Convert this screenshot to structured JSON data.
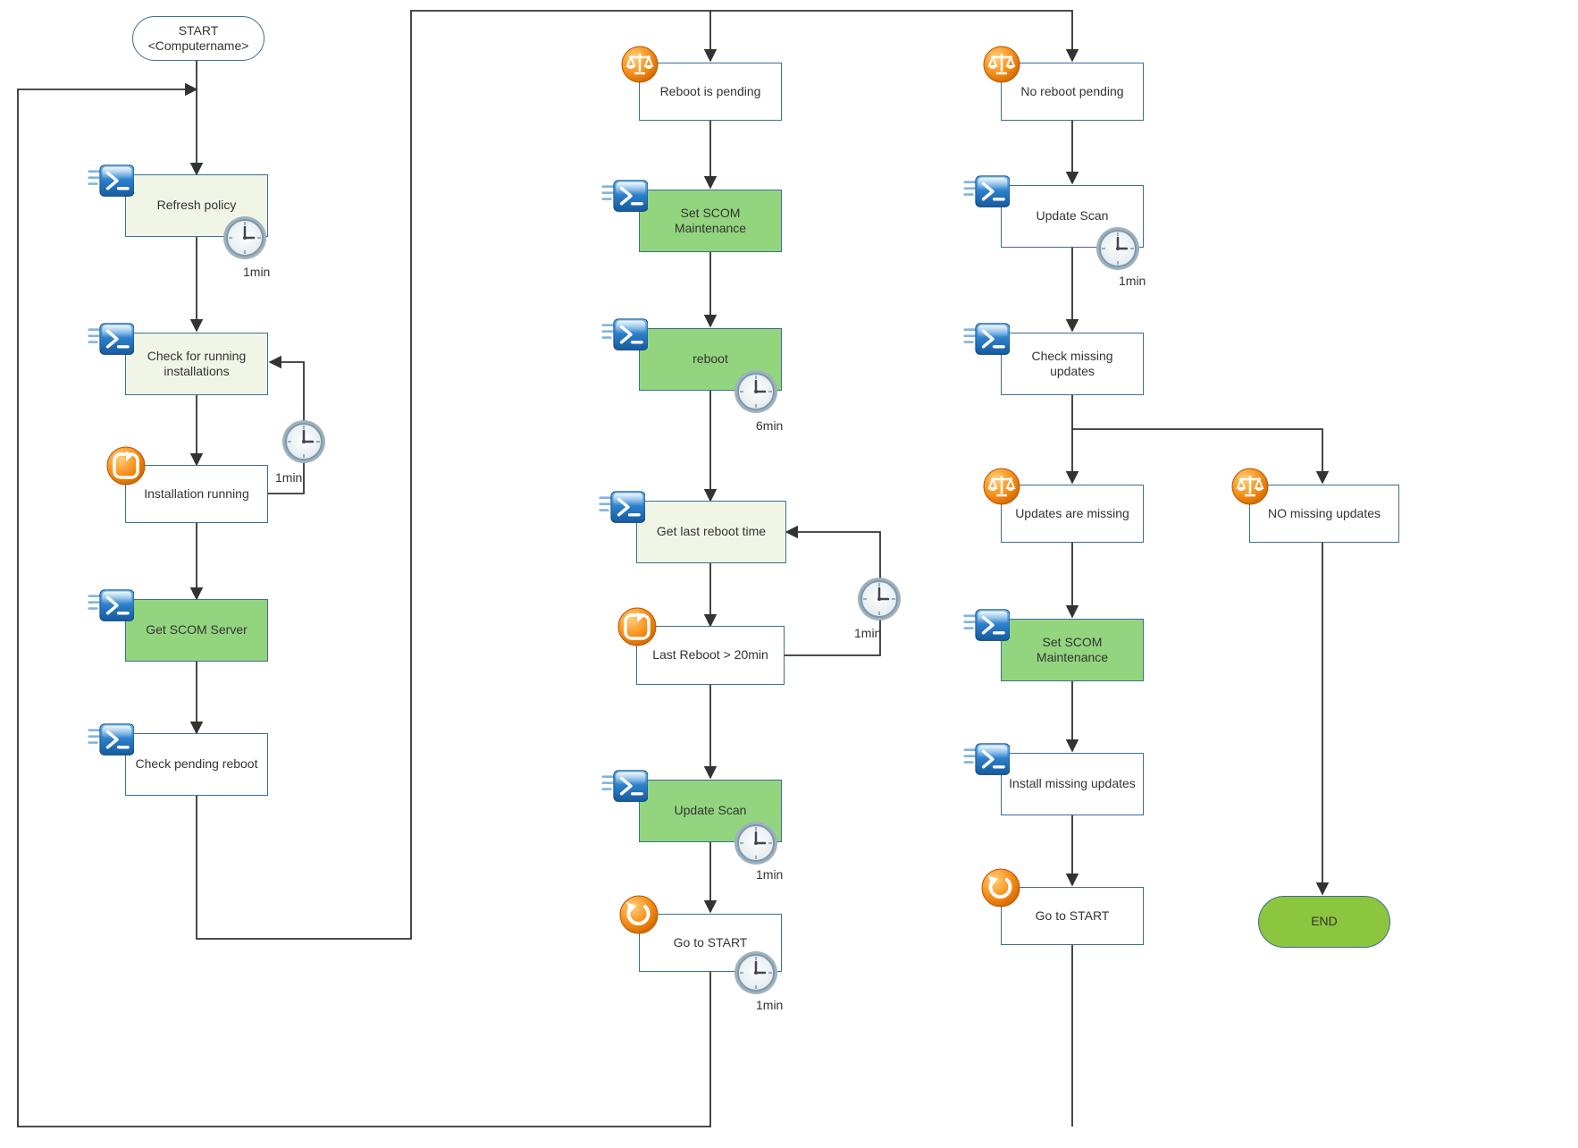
{
  "start_line1": "START",
  "start_line2": "<Computername>",
  "n_refresh_policy": "Refresh policy",
  "n_check_running": "Check for running installations",
  "n_install_running": "Installation running",
  "n_get_scom": "Get SCOM Server",
  "n_check_pending": "Check pending reboot",
  "n_reboot_pending": "Reboot is pending",
  "n_set_scom_1": "Set SCOM Maintenance",
  "n_reboot": "reboot",
  "n_last_reboot_time": "Get last reboot time",
  "n_last_reboot_gt20": "Last Reboot > 20min",
  "n_update_scan_1": "Update Scan",
  "n_goto_start_1": "Go to START",
  "n_no_reboot_pending": "No reboot pending",
  "n_update_scan_2": "Update Scan",
  "n_check_missing": "Check missing updates",
  "n_updates_missing": "Updates are missing",
  "n_no_missing": "NO missing updates",
  "n_set_scom_2": "Set SCOM Maintenance",
  "n_install_missing": "Install missing updates",
  "n_goto_start_2": "Go to START",
  "n_end": "END",
  "t_1min": "1min",
  "t_6min": "6min",
  "chart_data": {
    "type": "flowchart",
    "start": "START <Computername>",
    "end": "END",
    "nodes": [
      {
        "id": "A",
        "label": "Refresh policy",
        "kind": "powershell",
        "delay": "1min"
      },
      {
        "id": "B",
        "label": "Check for running installations",
        "kind": "powershell"
      },
      {
        "id": "C",
        "label": "Installation running",
        "kind": "loop-condition",
        "retry_delay": "1min"
      },
      {
        "id": "D",
        "label": "Get SCOM Server",
        "kind": "powershell"
      },
      {
        "id": "E",
        "label": "Check pending reboot",
        "kind": "powershell"
      },
      {
        "id": "F",
        "label": "Reboot is pending",
        "kind": "decision"
      },
      {
        "id": "G",
        "label": "Set SCOM Maintenance",
        "kind": "powershell"
      },
      {
        "id": "H",
        "label": "reboot",
        "kind": "powershell",
        "delay": "6min"
      },
      {
        "id": "I",
        "label": "Get last reboot time",
        "kind": "powershell"
      },
      {
        "id": "J",
        "label": "Last Reboot > 20min",
        "kind": "loop-condition",
        "retry_delay": "1min"
      },
      {
        "id": "K",
        "label": "Update Scan",
        "kind": "powershell",
        "delay": "1min"
      },
      {
        "id": "L",
        "label": "Go to START",
        "kind": "goto",
        "delay": "1min"
      },
      {
        "id": "M",
        "label": "No reboot pending",
        "kind": "decision"
      },
      {
        "id": "N",
        "label": "Update Scan",
        "kind": "powershell",
        "delay": "1min"
      },
      {
        "id": "O",
        "label": "Check missing updates",
        "kind": "powershell"
      },
      {
        "id": "P",
        "label": "Updates are missing",
        "kind": "decision"
      },
      {
        "id": "Q",
        "label": "NO missing updates",
        "kind": "decision"
      },
      {
        "id": "R",
        "label": "Set SCOM Maintenance",
        "kind": "powershell"
      },
      {
        "id": "S",
        "label": "Install missing updates",
        "kind": "powershell"
      },
      {
        "id": "T",
        "label": "Go to START",
        "kind": "goto"
      }
    ],
    "edges": [
      [
        "START",
        "A"
      ],
      [
        "A",
        "B"
      ],
      [
        "B",
        "C"
      ],
      [
        "C",
        "B",
        "loop while installation running (1min)"
      ],
      [
        "C",
        "D"
      ],
      [
        "D",
        "E"
      ],
      [
        "E",
        "decision-split"
      ],
      [
        "decision-split",
        "F"
      ],
      [
        "decision-split",
        "M"
      ],
      [
        "F",
        "G"
      ],
      [
        "G",
        "H"
      ],
      [
        "H",
        "I"
      ],
      [
        "I",
        "J"
      ],
      [
        "J",
        "I",
        "loop while last reboot > 20min (1min)"
      ],
      [
        "J",
        "K"
      ],
      [
        "K",
        "L"
      ],
      [
        "L",
        "START"
      ],
      [
        "M",
        "N"
      ],
      [
        "N",
        "O"
      ],
      [
        "O",
        "P"
      ],
      [
        "O",
        "Q"
      ],
      [
        "P",
        "R"
      ],
      [
        "R",
        "S"
      ],
      [
        "S",
        "T"
      ],
      [
        "T",
        "START"
      ],
      [
        "Q",
        "END"
      ]
    ]
  }
}
